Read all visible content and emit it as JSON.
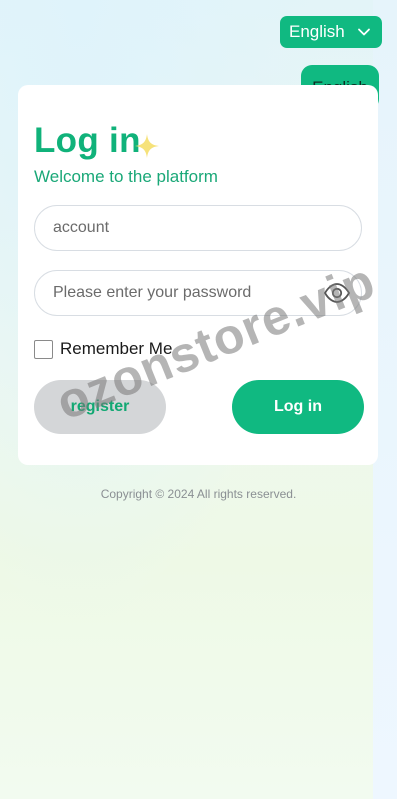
{
  "language": {
    "selected": "English",
    "chip_label": "English"
  },
  "login": {
    "title": "Log in",
    "subtitle": "Welcome to the platform",
    "account_placeholder": "account",
    "password_placeholder": "Please enter your password",
    "remember_label": "Remember Me",
    "remember_checked": false,
    "register_label": "register",
    "login_label": "Log in"
  },
  "footer": {
    "copyright": "Copyright © 2024 All rights reserved."
  },
  "watermark": {
    "text": "ozonstore.vip"
  },
  "icons": {
    "sparkle": "sparkle-icon",
    "eye": "eye-icon",
    "chevron": "chevron-down-icon"
  },
  "colors": {
    "accent": "#10b981",
    "title": "#10b27a",
    "register_bg": "#d4d6d8"
  }
}
